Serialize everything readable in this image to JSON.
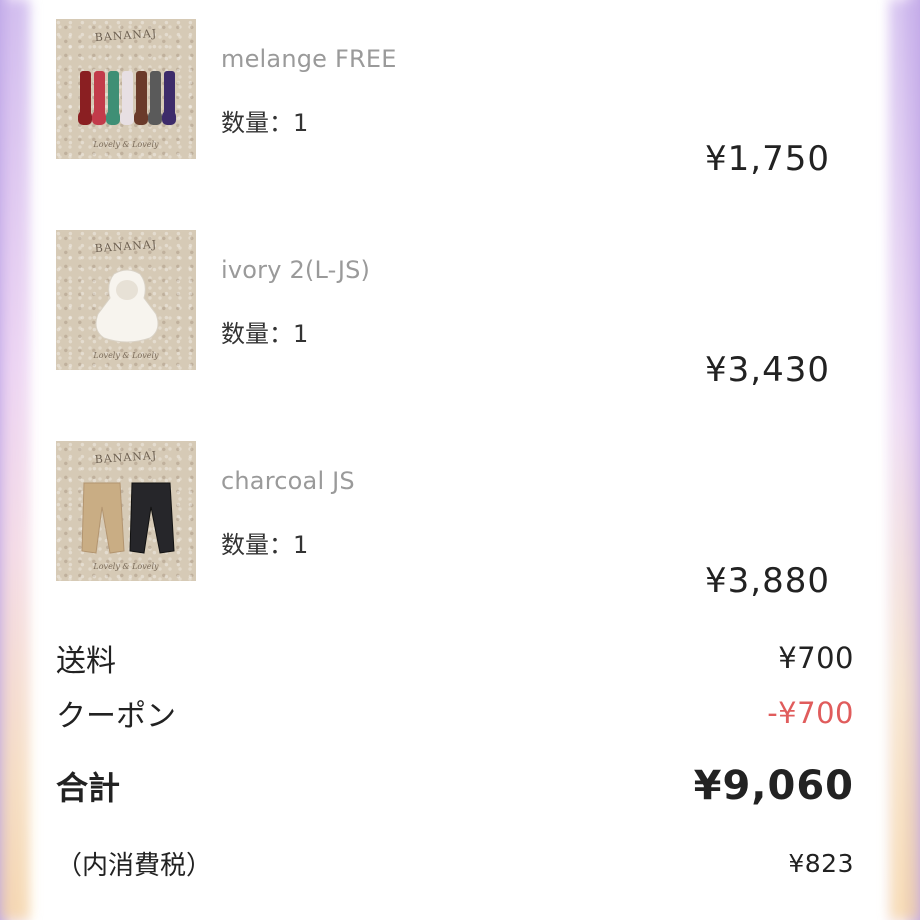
{
  "cart": {
    "items": [
      {
        "brand": "BANANAJ",
        "signature": "Lovely & Lovely",
        "variant": "melange FREE",
        "quantity": "数量：1",
        "price": "¥1,750"
      },
      {
        "brand": "BANANAJ",
        "signature": "Lovely & Lovely",
        "variant": "ivory 2(L-JS)",
        "quantity": "数量：1",
        "price": "¥3,430"
      },
      {
        "brand": "BANANAJ",
        "signature": "Lovely & Lovely",
        "variant": "charcoal JS",
        "quantity": "数量：1",
        "price": "¥3,880"
      }
    ]
  },
  "summary": {
    "shipping_label": "送料",
    "shipping_value": "¥700",
    "coupon_label": "クーポン",
    "coupon_value": "-¥700",
    "total_label": "合計",
    "total_value": "¥9,060",
    "tax_label": "（内消費税）",
    "tax_value": "¥823"
  },
  "colors": {
    "discount": "#e05c5c",
    "variant_text": "#9a9a9a",
    "thumb_bg": "#d6cab6"
  }
}
